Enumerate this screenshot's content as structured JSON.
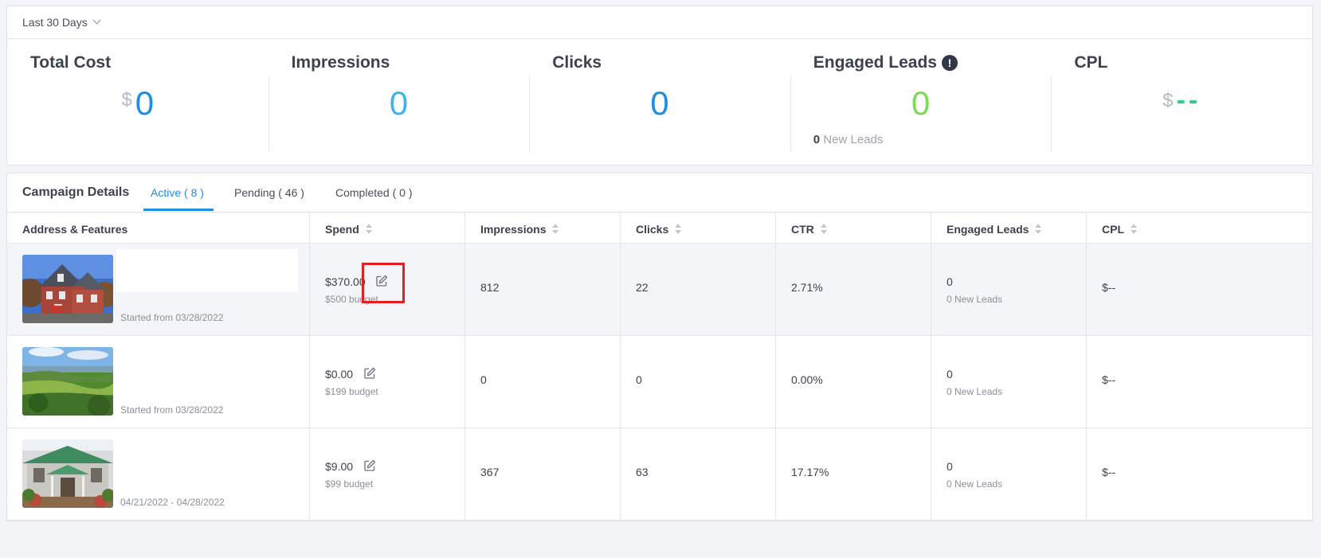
{
  "date_filter": {
    "label": "Last 30 Days"
  },
  "metrics": [
    {
      "label": "Total Cost",
      "currency": "$",
      "value": "0",
      "color": "#1e8fe0"
    },
    {
      "label": "Impressions",
      "value": "0",
      "color": "#3db5ef"
    },
    {
      "label": "Clicks",
      "value": "0",
      "color": "#1e8fe0"
    },
    {
      "label": "Engaged Leads",
      "value": "0",
      "color": "#7ed957",
      "note_count": "0",
      "note_label": "New Leads"
    },
    {
      "label": "CPL",
      "currency": "$",
      "value": "--",
      "color": "#2dd185"
    }
  ],
  "campaign": {
    "title": "Campaign Details",
    "tabs": [
      {
        "label": "Active ( 8 )",
        "active": true
      },
      {
        "label": "Pending ( 46 )",
        "active": false
      },
      {
        "label": "Completed ( 0 )",
        "active": false
      }
    ],
    "columns": [
      "Address & Features",
      "Spend",
      "Impressions",
      "Clicks",
      "CTR",
      "Engaged Leads",
      "CPL"
    ],
    "rows": [
      {
        "date_text": "Started from 03/28/2022",
        "spend": "$370.00",
        "budget": "$500 budget",
        "impressions": "812",
        "clicks": "22",
        "ctr": "2.71%",
        "leads": "0",
        "new_leads": "0 New Leads",
        "cpl": "$--",
        "thumbnail": "house-photo"
      },
      {
        "date_text": "Started from 03/28/2022",
        "spend": "$0.00",
        "budget": "$199 budget",
        "impressions": "0",
        "clicks": "0",
        "ctr": "0.00%",
        "leads": "0",
        "new_leads": "0 New Leads",
        "cpl": "$--",
        "thumbnail": "landscape-photo"
      },
      {
        "date_text": "04/21/2022 - 04/28/2022",
        "spend": "$9.00",
        "budget": "$99 budget",
        "impressions": "367",
        "clicks": "63",
        "ctr": "17.17%",
        "leads": "0",
        "new_leads": "0 New Leads",
        "cpl": "$--",
        "thumbnail": "townhouse-photo"
      }
    ]
  },
  "colors": {
    "accent": "#1e8fe0",
    "highlight": "#e31e24"
  }
}
